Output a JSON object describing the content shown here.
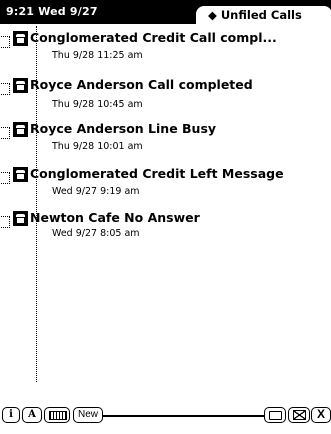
{
  "status": {
    "clock": "9:21 Wed 9/27"
  },
  "folder_tab": {
    "label": "◆ Unfiled Calls"
  },
  "calls": [
    {
      "title": "Conglomerated Credit  Call compl...",
      "date": "Thu 9/28 11:25 am"
    },
    {
      "title": "Royce Anderson  Call completed",
      "date": "Thu 9/28 10:45 am"
    },
    {
      "title": "Royce Anderson  Line Busy",
      "date": "Thu 9/28 10:01 am"
    },
    {
      "title": "Conglomerated Credit  Left Message",
      "date": "Wed 9/27 9:19 am"
    },
    {
      "title": "Newton Cafe  No Answer",
      "date": "Wed 9/27 8:05 am"
    }
  ],
  "toolbar": {
    "info": "i",
    "a": "A",
    "new": "New",
    "close": "X"
  }
}
